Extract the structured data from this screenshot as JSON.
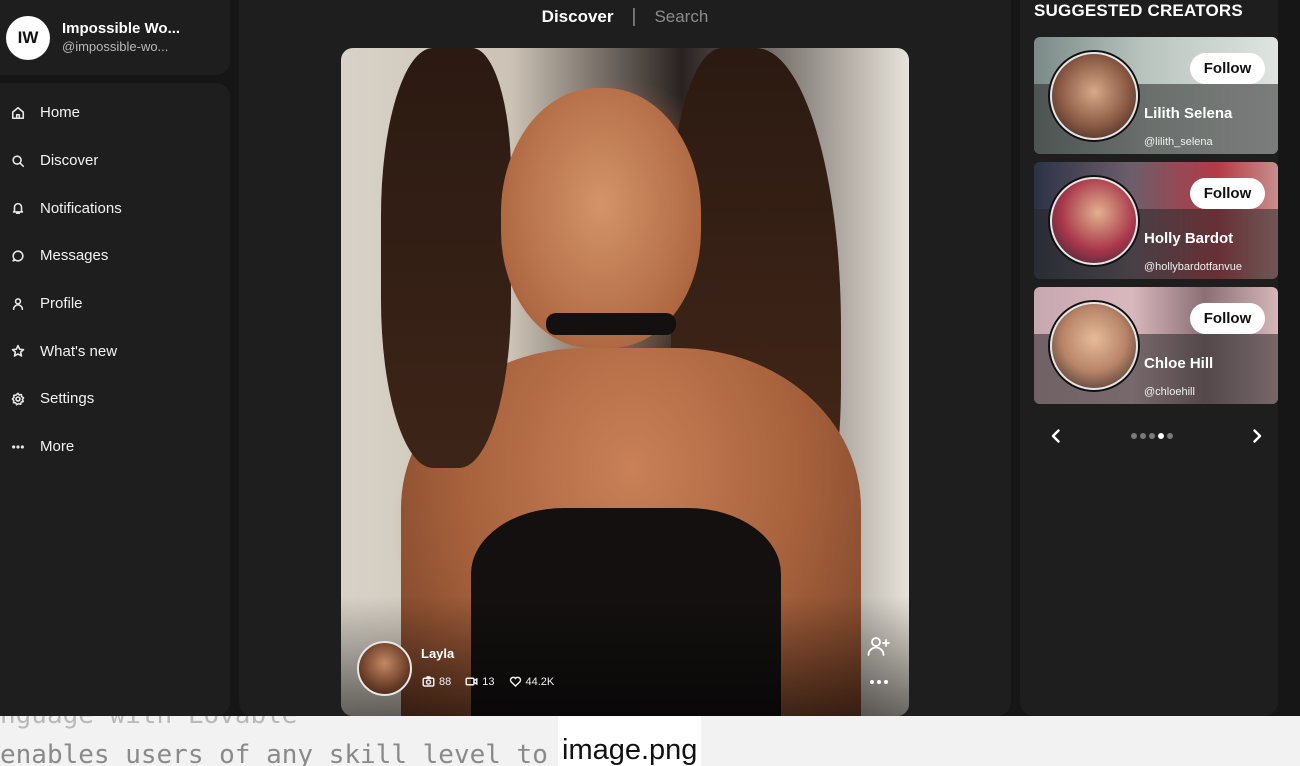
{
  "profile": {
    "initials": "IW",
    "name": "Impossible Wo...",
    "handle": "@impossible-wo..."
  },
  "nav": {
    "items": [
      {
        "label": "Home",
        "icon": "home-icon"
      },
      {
        "label": "Discover",
        "icon": "search-icon"
      },
      {
        "label": "Notifications",
        "icon": "bell-icon"
      },
      {
        "label": "Messages",
        "icon": "chat-bubble-icon"
      },
      {
        "label": "Profile",
        "icon": "person-icon"
      },
      {
        "label": "What's new",
        "icon": "star-icon"
      },
      {
        "label": "Settings",
        "icon": "gear-icon"
      },
      {
        "label": "More",
        "icon": "ellipsis-icon"
      }
    ]
  },
  "tabs": {
    "discover": "Discover",
    "separator": "|",
    "search": "Search"
  },
  "post": {
    "creator_name": "Layla",
    "photos": "88",
    "videos": "13",
    "likes": "44.2K",
    "icons": [
      "camera-icon",
      "video-icon",
      "heart-icon",
      "add-person-icon",
      "more-options-icon"
    ]
  },
  "suggested": {
    "title": "SUGGESTED CREATORS",
    "creators": [
      {
        "name": "Lilith Selena",
        "handle": "@lilith_selena",
        "follow": "Follow"
      },
      {
        "name": "Holly Bardot",
        "handle": "@hollybardotfanvue",
        "follow": "Follow"
      },
      {
        "name": "Chloe Hill",
        "handle": "@chloehill",
        "follow": "Follow"
      }
    ],
    "pagination": {
      "pages": 5,
      "active_page": 4
    }
  },
  "background_window": {
    "line1": "nguage with Lovable",
    "line2": "enables users of any skill level to create",
    "caption": "image.png"
  }
}
